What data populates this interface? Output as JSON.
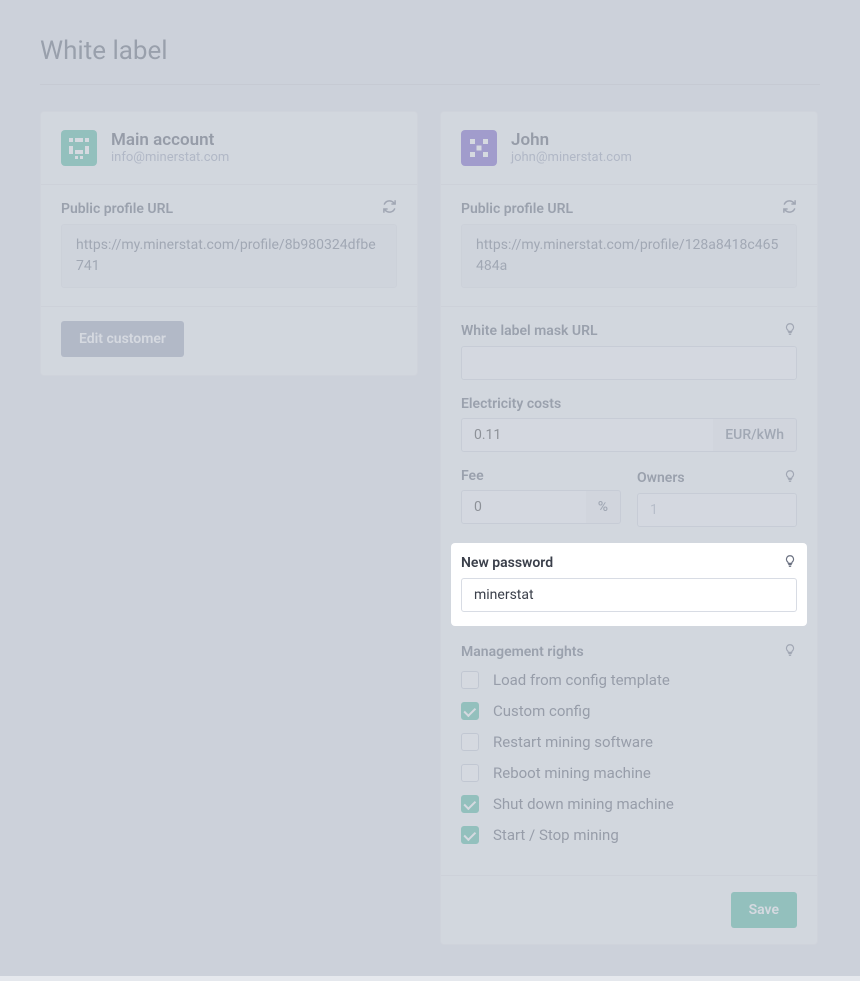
{
  "page_title": "White label",
  "left": {
    "name": "Main account",
    "email": "info@minerstat.com",
    "profile_label": "Public profile URL",
    "profile_url": "https://my.minerstat.com/profile/8b980324dfbe741",
    "edit_btn": "Edit customer"
  },
  "right": {
    "name": "John",
    "email": "john@minerstat.com",
    "profile_label": "Public profile URL",
    "profile_url": "https://my.minerstat.com/profile/128a8418c465484a",
    "mask_label": "White label mask URL",
    "mask_value": "",
    "elec_label": "Electricity costs",
    "elec_value": "0.11",
    "elec_unit": "EUR/kWh",
    "fee_label": "Fee",
    "fee_value": "0",
    "fee_unit": "%",
    "owners_label": "Owners",
    "owners_placeholder": "1",
    "password_label": "New password",
    "password_value": "minerstat",
    "rights_label": "Management rights",
    "rights": [
      {
        "label": "Load from config template",
        "checked": false
      },
      {
        "label": "Custom config",
        "checked": true
      },
      {
        "label": "Restart mining software",
        "checked": false
      },
      {
        "label": "Reboot mining machine",
        "checked": false
      },
      {
        "label": "Shut down mining machine",
        "checked": true
      },
      {
        "label": "Start / Stop mining",
        "checked": true
      }
    ],
    "save_btn": "Save"
  },
  "colors": {
    "teal": "#42b79a",
    "purple": "#6b52c5"
  }
}
